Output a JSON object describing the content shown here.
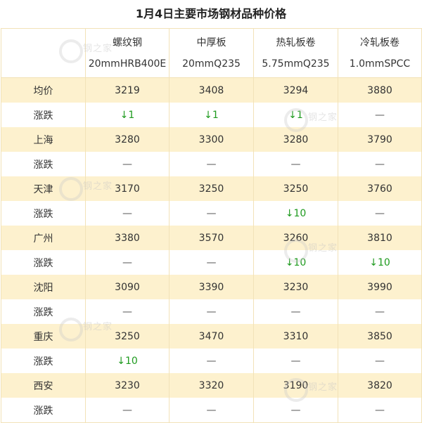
{
  "title": "1月4日主要市场钢材品种价格",
  "header": [
    {
      "name": "螺纹钢",
      "spec": "20mmHRB400E"
    },
    {
      "name": "中厚板",
      "spec": "20mmQ235"
    },
    {
      "name": "热轧板卷",
      "spec": "5.75mmQ235"
    },
    {
      "name": "冷轧板卷",
      "spec": "1.0mmSPCC"
    }
  ],
  "rows": [
    {
      "label": "均价",
      "cells": [
        "3219",
        "3408",
        "3294",
        "3880"
      ]
    },
    {
      "label": "涨跌",
      "cells": [
        "↓1",
        "↓1",
        "↓1",
        "—"
      ]
    },
    {
      "label": "上海",
      "cells": [
        "3280",
        "3300",
        "3280",
        "3790"
      ]
    },
    {
      "label": "涨跌",
      "cells": [
        "—",
        "—",
        "—",
        "—"
      ]
    },
    {
      "label": "天津",
      "cells": [
        "3170",
        "3250",
        "3250",
        "3760"
      ]
    },
    {
      "label": "涨跌",
      "cells": [
        "—",
        "—",
        "↓10",
        "—"
      ]
    },
    {
      "label": "广州",
      "cells": [
        "3380",
        "3570",
        "3260",
        "3810"
      ]
    },
    {
      "label": "涨跌",
      "cells": [
        "—",
        "—",
        "↓10",
        "↓10"
      ]
    },
    {
      "label": "沈阳",
      "cells": [
        "3090",
        "3390",
        "3230",
        "3990"
      ]
    },
    {
      "label": "涨跌",
      "cells": [
        "—",
        "—",
        "—",
        "—"
      ]
    },
    {
      "label": "重庆",
      "cells": [
        "3250",
        "3470",
        "3310",
        "3850"
      ]
    },
    {
      "label": "涨跌",
      "cells": [
        "↓10",
        "—",
        "—",
        "—"
      ]
    },
    {
      "label": "西安",
      "cells": [
        "3230",
        "3320",
        "3190",
        "3820"
      ]
    },
    {
      "label": "涨跌",
      "cells": [
        "—",
        "—",
        "—",
        "—"
      ]
    }
  ],
  "watermark": "钢之家",
  "colors": {
    "band": "#fdf1ce",
    "down": "#1e9a1e",
    "border": "#f2e2b8"
  }
}
